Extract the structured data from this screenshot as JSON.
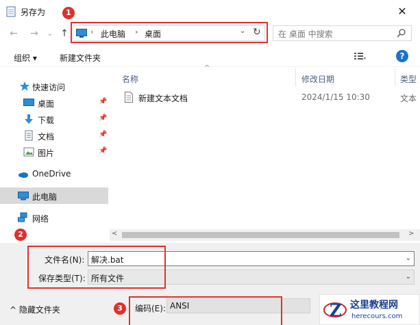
{
  "window": {
    "title": "另存为",
    "close_glyph": "✕"
  },
  "nav": {
    "back_glyph": "←",
    "forward_glyph": "→",
    "recent_glyph": "⌄",
    "up_glyph": "↑",
    "breadcrumb": [
      "此电脑",
      "桌面"
    ],
    "crumb_sep": "›",
    "dropdown_glyph": "⌄",
    "refresh_glyph": "↻",
    "search_placeholder": "在 桌面 中搜索"
  },
  "toolbar": {
    "organize": "组织 ▾",
    "new_folder": "新建文件夹",
    "help": "?"
  },
  "sidebar": {
    "quick_access": "快速访问",
    "items": [
      {
        "label": "桌面",
        "icon": "desktop-icon",
        "pinned": true
      },
      {
        "label": "下载",
        "icon": "download-icon",
        "pinned": true
      },
      {
        "label": "文档",
        "icon": "document-icon",
        "pinned": true
      },
      {
        "label": "图片",
        "icon": "picture-icon",
        "pinned": true
      }
    ],
    "onedrive": "OneDrive",
    "this_pc": "此电脑",
    "network": "网络",
    "pin_glyph": "📌"
  },
  "filelist": {
    "columns": [
      "名称",
      "修改日期",
      "类型"
    ],
    "sort_glyph": "^",
    "rows": [
      {
        "name": "新建文本文档",
        "date": "2024/1/15 10:30",
        "type": "文本"
      }
    ]
  },
  "scroll": {
    "left": "<",
    "right": ">"
  },
  "form": {
    "filename_label": "文件名(N):",
    "filename_value": "解决.bat",
    "filetype_label": "保存类型(T):",
    "filetype_value": "所有文件",
    "dd_glyph": "⌄"
  },
  "footer": {
    "hide_folders": "^ 隐藏文件夹",
    "encoding_label": "编码(E):",
    "encoding_value": "ANSI"
  },
  "annotations": [
    "1",
    "2",
    "3"
  ],
  "watermark": {
    "name": "这里教程网",
    "url": "herecours.com",
    "logo_letter": "Z"
  },
  "colors": {
    "accent": "#1a73c9",
    "annotation": "#e0302d"
  }
}
